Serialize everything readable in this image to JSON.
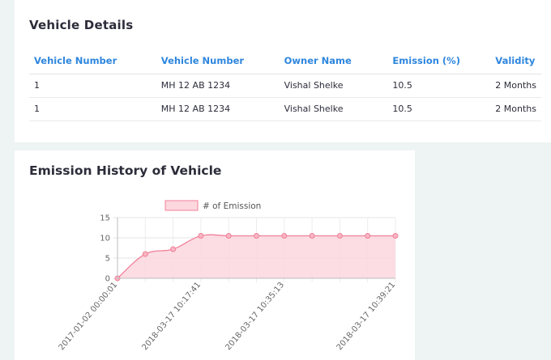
{
  "details": {
    "title": "Vehicle Details",
    "columns": [
      "Vehicle Number",
      "Vehicle Number",
      "Owner Name",
      "Emission (%)",
      "Validity"
    ],
    "rows": [
      [
        "1",
        "MH 12 AB 1234",
        "Vishal Shelke",
        "10.5",
        "2 Months"
      ],
      [
        "1",
        "MH 12 AB 1234",
        "Vishal Shelke",
        "10.5",
        "2 Months"
      ]
    ]
  },
  "history": {
    "title": "Emission History of Vehicle"
  },
  "colors": {
    "header_text": "#2e86de",
    "series_line": "#f08098",
    "series_fill": "#fcd7de"
  },
  "chart_data": {
    "type": "area",
    "x": [
      "2017-01-02 00:00:01",
      "",
      "",
      "2018-03-17 10:17:41",
      "",
      "",
      "2018-03-17 10:35:13",
      "",
      "",
      "",
      "2018-03-17 10:39:21"
    ],
    "series": [
      {
        "name": "# of Emission",
        "values": [
          0,
          6,
          7.2,
          10.5,
          10.5,
          10.5,
          10.5,
          10.5,
          10.5,
          10.5,
          10.5
        ]
      }
    ],
    "ylim": [
      0,
      15
    ],
    "yticks": [
      0,
      5,
      10,
      15
    ],
    "grid": true,
    "legend": "top"
  }
}
